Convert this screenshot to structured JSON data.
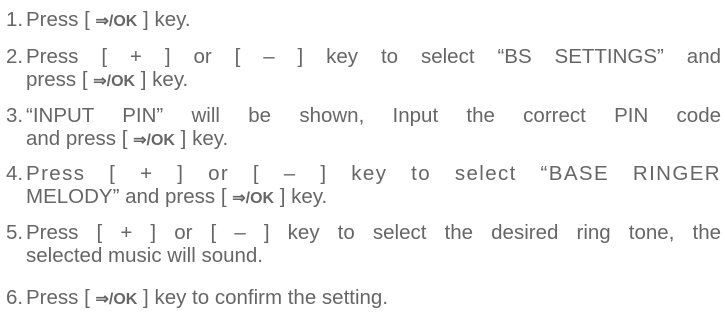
{
  "steps": [
    {
      "number": "1.",
      "lines": [
        {
          "pre": "Press [ ",
          "key_icon": "enter-ok-icon",
          "key": "⇒/OK",
          "post": " ] key."
        }
      ]
    },
    {
      "number": "2.",
      "lines": [
        {
          "text": "Press [ + ] or [ – ] key to select “BS SETTINGS” and"
        },
        {
          "pre": "press [ ",
          "key": "⇒/OK",
          "post": " ] key."
        }
      ]
    },
    {
      "number": "3.",
      "lines": [
        {
          "text": "“INPUT PIN” will be shown, Input the correct PIN code"
        },
        {
          "pre": "and press [ ",
          "key": "⇒/OK",
          "post": " ] key."
        }
      ]
    },
    {
      "number": "4.",
      "lines": [
        {
          "text": "Press [ + ] or [ – ] key to select “BASE RINGER"
        },
        {
          "pre": "MELODY” and press [ ",
          "key": "⇒/OK",
          "post": " ] key."
        }
      ]
    },
    {
      "number": "5.",
      "lines": [
        {
          "text": "Press [ + ] or [ – ] key to select the desired ring tone, the"
        },
        {
          "text": "selected music will sound."
        }
      ]
    },
    {
      "number": "6.",
      "lines": [
        {
          "pre": "Press [ ",
          "key": "⇒/OK",
          "post": " ] key to confirm the setting."
        }
      ]
    }
  ]
}
